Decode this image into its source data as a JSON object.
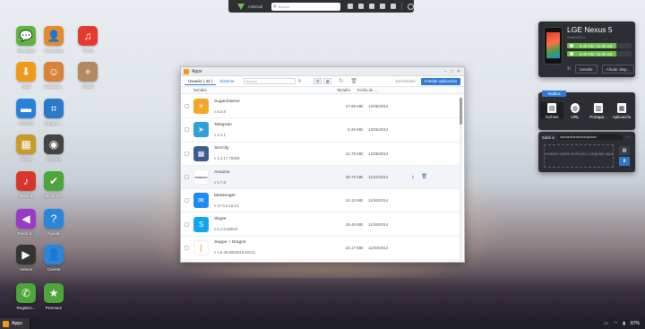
{
  "topbar": {
    "brand": "AirDroid",
    "search_placeholder": "Buscar"
  },
  "desktop": {
    "icons": [
      {
        "label": "Mensajes",
        "color": "#5fb340",
        "glyph": "💬"
      },
      {
        "label": "Contactos",
        "color": "#e58a2b",
        "glyph": "👤"
      },
      {
        "label": "Tonos",
        "color": "#e53b2f",
        "glyph": "♫"
      },
      {
        "label": "Apps",
        "color": "#f09a1a",
        "glyph": "⬇"
      },
      {
        "label": "Contacto...",
        "color": "#d9823a",
        "glyph": "☺"
      },
      {
        "label": "Añadir",
        "color": "#b28a62",
        "glyph": "+"
      },
      {
        "label": "Archivos",
        "color": "#2a82d8",
        "glyph": "▬"
      },
      {
        "label": "Captura ...",
        "color": "#2a7ac8",
        "glyph": "⌗"
      },
      {
        "label": "Fotos",
        "color": "#c89a2a",
        "glyph": "▦"
      },
      {
        "label": "Cámara",
        "color": "#444444",
        "glyph": "◉"
      },
      {
        "label": "Música",
        "color": "#d8362b",
        "glyph": "♪"
      },
      {
        "label": "Ubicar el ...",
        "color": "#4da63a",
        "glyph": "✔"
      },
      {
        "label": "Tonos d...",
        "color": "#9a3ac8",
        "glyph": "◀"
      },
      {
        "label": "Ayuda",
        "color": "#2a86d8",
        "glyph": "?"
      },
      {
        "label": "Videos",
        "color": "#333333",
        "glyph": "▶"
      },
      {
        "label": "Cuenta",
        "color": "#2a86d8",
        "glyph": "👤"
      },
      {
        "label": "Registro...",
        "color": "#4da63a",
        "glyph": "✆"
      },
      {
        "label": "Premium",
        "color": "#4da63a",
        "glyph": "★"
      }
    ]
  },
  "window": {
    "title": "Apps",
    "tabs": {
      "user": "Usuario ( 42 )",
      "system": "Sistema"
    },
    "search_placeholder": "Buscar",
    "uninstall_label": "Desinstalar",
    "install_label": "Instalar aplicación",
    "columns": {
      "name": "Nombre",
      "size": "Tamaño",
      "date": "Fecha de ..."
    },
    "apps": [
      {
        "name": "Sugarcharmz",
        "version": "v 5.0.8",
        "size": "17.89 MB",
        "date": "12/05/2014",
        "color": "#f4a623",
        "glyph": "✶"
      },
      {
        "name": "Telegram",
        "version": "v 2.1.1",
        "size": "5.33 MB",
        "date": "12/05/2014",
        "color": "#2fa0db",
        "glyph": "➤"
      },
      {
        "name": "SimCity",
        "version": "v 1.2.17.76369",
        "size": "14.79 MB",
        "date": "12/05/2014",
        "color": "#3b5d8c",
        "glyph": "▦"
      },
      {
        "name": "Amazon",
        "version": "v 5.7.8",
        "size": "28.79 MB",
        "date": "11/22/2014",
        "color": "#ffffff",
        "glyph": "amazon"
      },
      {
        "name": "Messenger",
        "version": "v 17.0.0.16.14",
        "size": "14.13 MB",
        "date": "11/26/2014",
        "color": "#1e8bf0",
        "glyph": "✉"
      },
      {
        "name": "Skype",
        "version": "v 5.1.0.58619",
        "size": "18.48 MB",
        "date": "11/26/2014",
        "color": "#12a5ef",
        "glyph": "S"
      },
      {
        "name": "Swype + Dragon",
        "version": "v 1.6.29.9952816.92211",
        "size": "23.17 MB",
        "date": "11/20/2014",
        "color": "#ffffff",
        "glyph": "ʃ"
      }
    ],
    "hover_actions": [
      "⭳",
      "🗑"
    ]
  },
  "device": {
    "name": "LGE Nexus 5",
    "subtitle": "Android 5.0",
    "storage": [
      {
        "text": "9.49 GB / 12.55 GB",
        "fraction": 0.76
      },
      {
        "text": "9.49 GB / 12.55 GB",
        "fraction": 0.76
      }
    ],
    "detail_label": "Detalle",
    "add_label": "Añadir disp..."
  },
  "tools": {
    "header": "Toolbox",
    "items": [
      "Archivo",
      "URL",
      "Portapa...",
      "Aplicación"
    ]
  },
  "upload": {
    "label": "Subir a",
    "path": "/sdcard/android/upload",
    "drop_text": "Arrastre suelte archivos o carpetas aquí"
  },
  "taskbar": {
    "task_label": "Apps",
    "battery": "87%"
  }
}
